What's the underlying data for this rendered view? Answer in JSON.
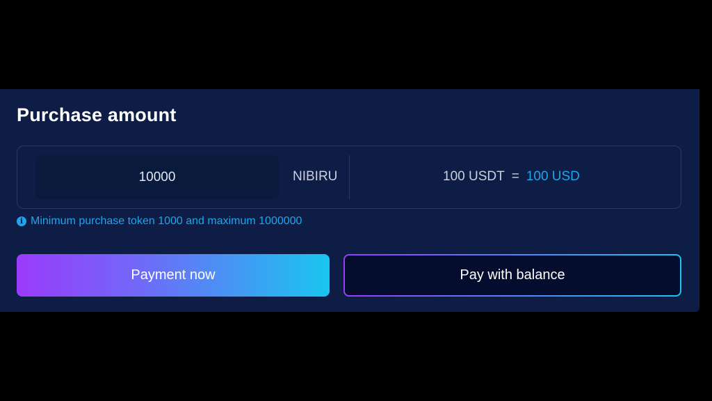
{
  "purchase": {
    "title": "Purchase amount",
    "amount_value": "10000",
    "token": "NIBIRU",
    "rate": {
      "left": "100 USDT",
      "equals": "=",
      "right": "100 USD"
    },
    "info_icon": "info-icon",
    "note": "Minimum purchase token 1000 and maximum 1000000"
  },
  "buttons": {
    "pay_now": "Payment now",
    "pay_balance": "Pay with balance"
  },
  "colors": {
    "panel_bg": "#0d1d45",
    "accent_blue": "#1ea5ef",
    "gradient_start": "#9b3bfb",
    "gradient_end": "#19c6ef"
  }
}
